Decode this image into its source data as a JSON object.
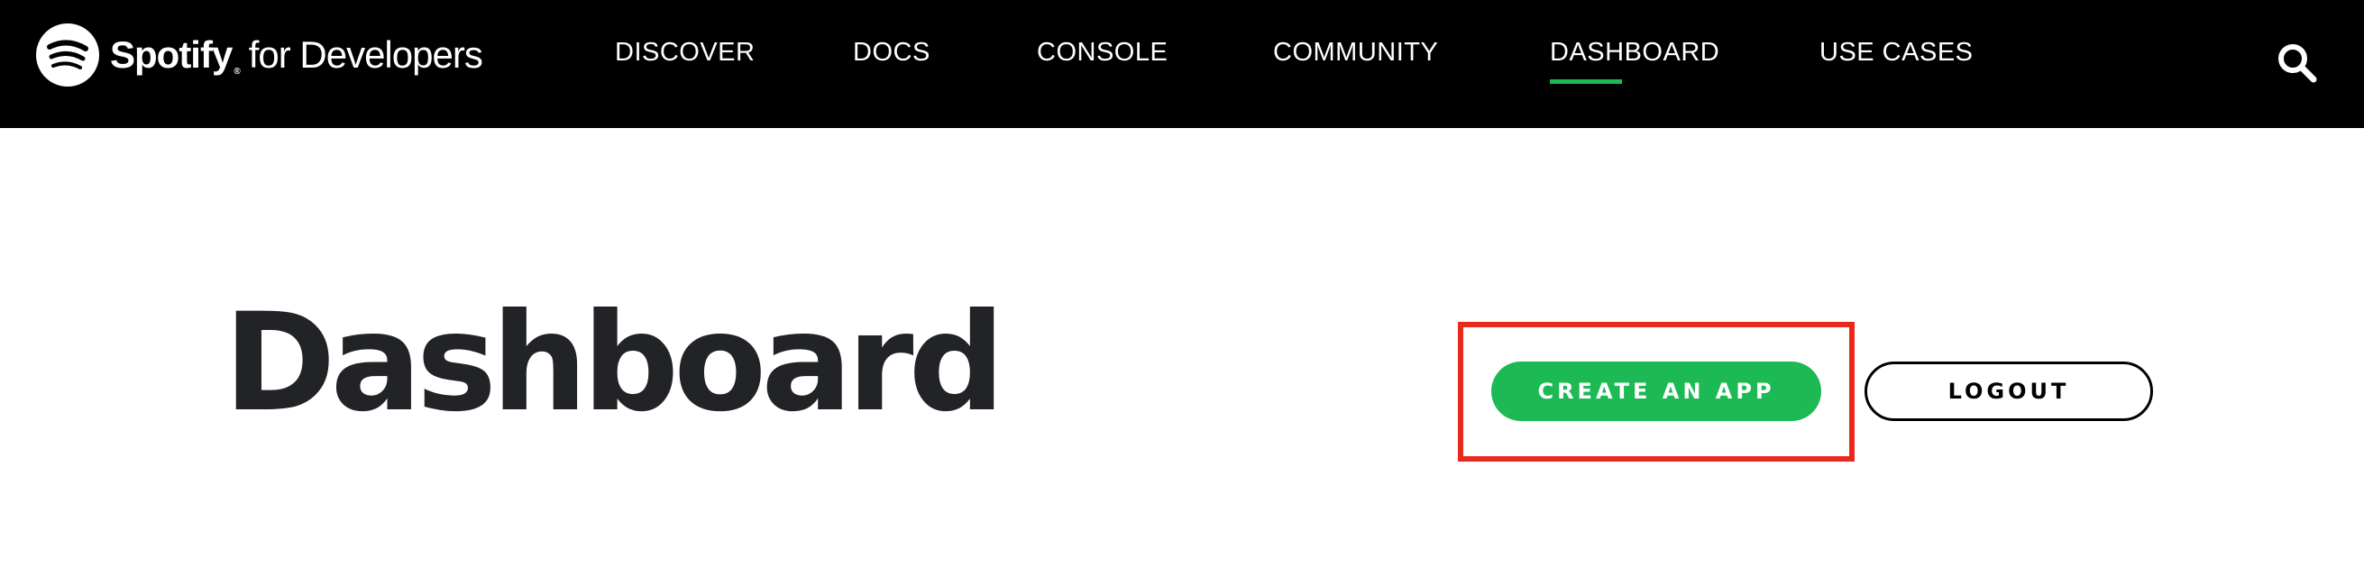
{
  "header": {
    "brand": "Spotify",
    "brand_mark": "®",
    "brand_sub": "for Developers",
    "nav": [
      {
        "label": "DISCOVER",
        "active": false
      },
      {
        "label": "DOCS",
        "active": false
      },
      {
        "label": "CONSOLE",
        "active": false
      },
      {
        "label": "COMMUNITY",
        "active": false
      },
      {
        "label": "DASHBOARD",
        "active": true
      },
      {
        "label": "USE CASES",
        "active": false
      }
    ],
    "search_icon": "search-icon"
  },
  "main": {
    "title": "Dashboard",
    "create_app_label": "CREATE AN APP",
    "logout_label": "LOGOUT"
  },
  "colors": {
    "header_bg": "#000000",
    "accent_green": "#1db954",
    "title_text": "#222326",
    "highlight_border": "#e8291c"
  }
}
